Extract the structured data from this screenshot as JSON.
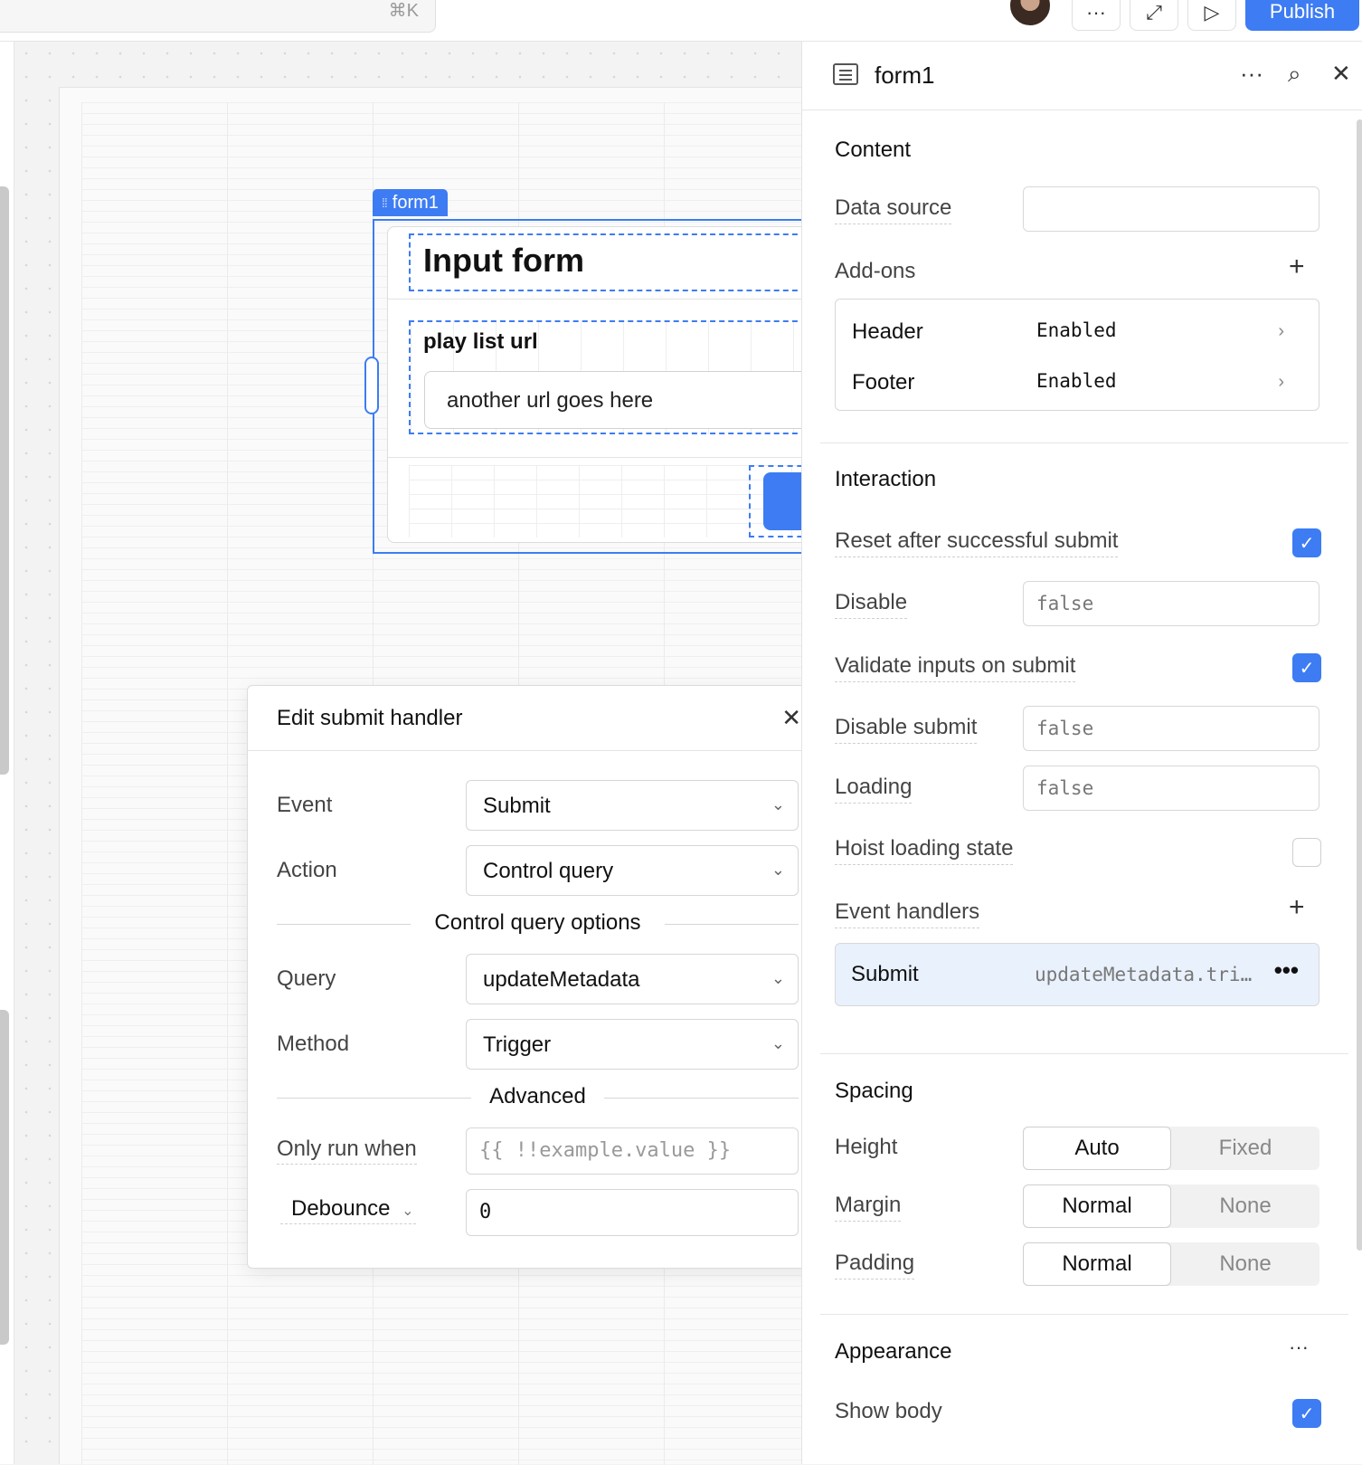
{
  "topbar": {
    "search_shortcut": "⌘K",
    "more_icon": "···",
    "expand_icon": "⤢",
    "preview_icon": "▷",
    "publish_label": "Publish"
  },
  "canvas": {
    "form_tag": "form1",
    "form_title": "Input form",
    "field_label": "play list url",
    "field_value": "another url goes here"
  },
  "dialog": {
    "title": "Edit submit handler",
    "close_icon": "✕",
    "event_label": "Event",
    "event_value": "Submit",
    "action_label": "Action",
    "action_value": "Control query",
    "section_options": "Control query options",
    "query_label": "Query",
    "query_value": "updateMetadata",
    "method_label": "Method",
    "method_value": "Trigger",
    "section_advanced": "Advanced",
    "only_run_label": "Only run when",
    "only_run_placeholder": "{{ !!example.value }}",
    "debounce_label": "Debounce",
    "debounce_value": "0"
  },
  "inspector": {
    "title": "form1",
    "content": {
      "title": "Content",
      "data_source_label": "Data source",
      "data_source_value": "",
      "addons_label": "Add-ons",
      "addons": [
        {
          "name": "Header",
          "value": "Enabled"
        },
        {
          "name": "Footer",
          "value": "Enabled"
        }
      ]
    },
    "interaction": {
      "title": "Interaction",
      "reset_label": "Reset after successful submit",
      "reset_checked": true,
      "disable_label": "Disable",
      "disable_value": "false",
      "validate_label": "Validate inputs on submit",
      "validate_checked": true,
      "disable_submit_label": "Disable submit",
      "disable_submit_value": "false",
      "loading_label": "Loading",
      "loading_value": "false",
      "hoist_label": "Hoist loading state",
      "hoist_checked": false,
      "event_handlers_label": "Event handlers",
      "handler_name": "Submit",
      "handler_value": "updateMetadata.tri…"
    },
    "spacing": {
      "title": "Spacing",
      "height_label": "Height",
      "height_options": [
        "Auto",
        "Fixed"
      ],
      "margin_label": "Margin",
      "margin_options": [
        "Normal",
        "None"
      ],
      "padding_label": "Padding",
      "padding_options": [
        "Normal",
        "None"
      ]
    },
    "appearance": {
      "title": "Appearance",
      "show_body_label": "Show body",
      "show_body_checked": true
    }
  }
}
